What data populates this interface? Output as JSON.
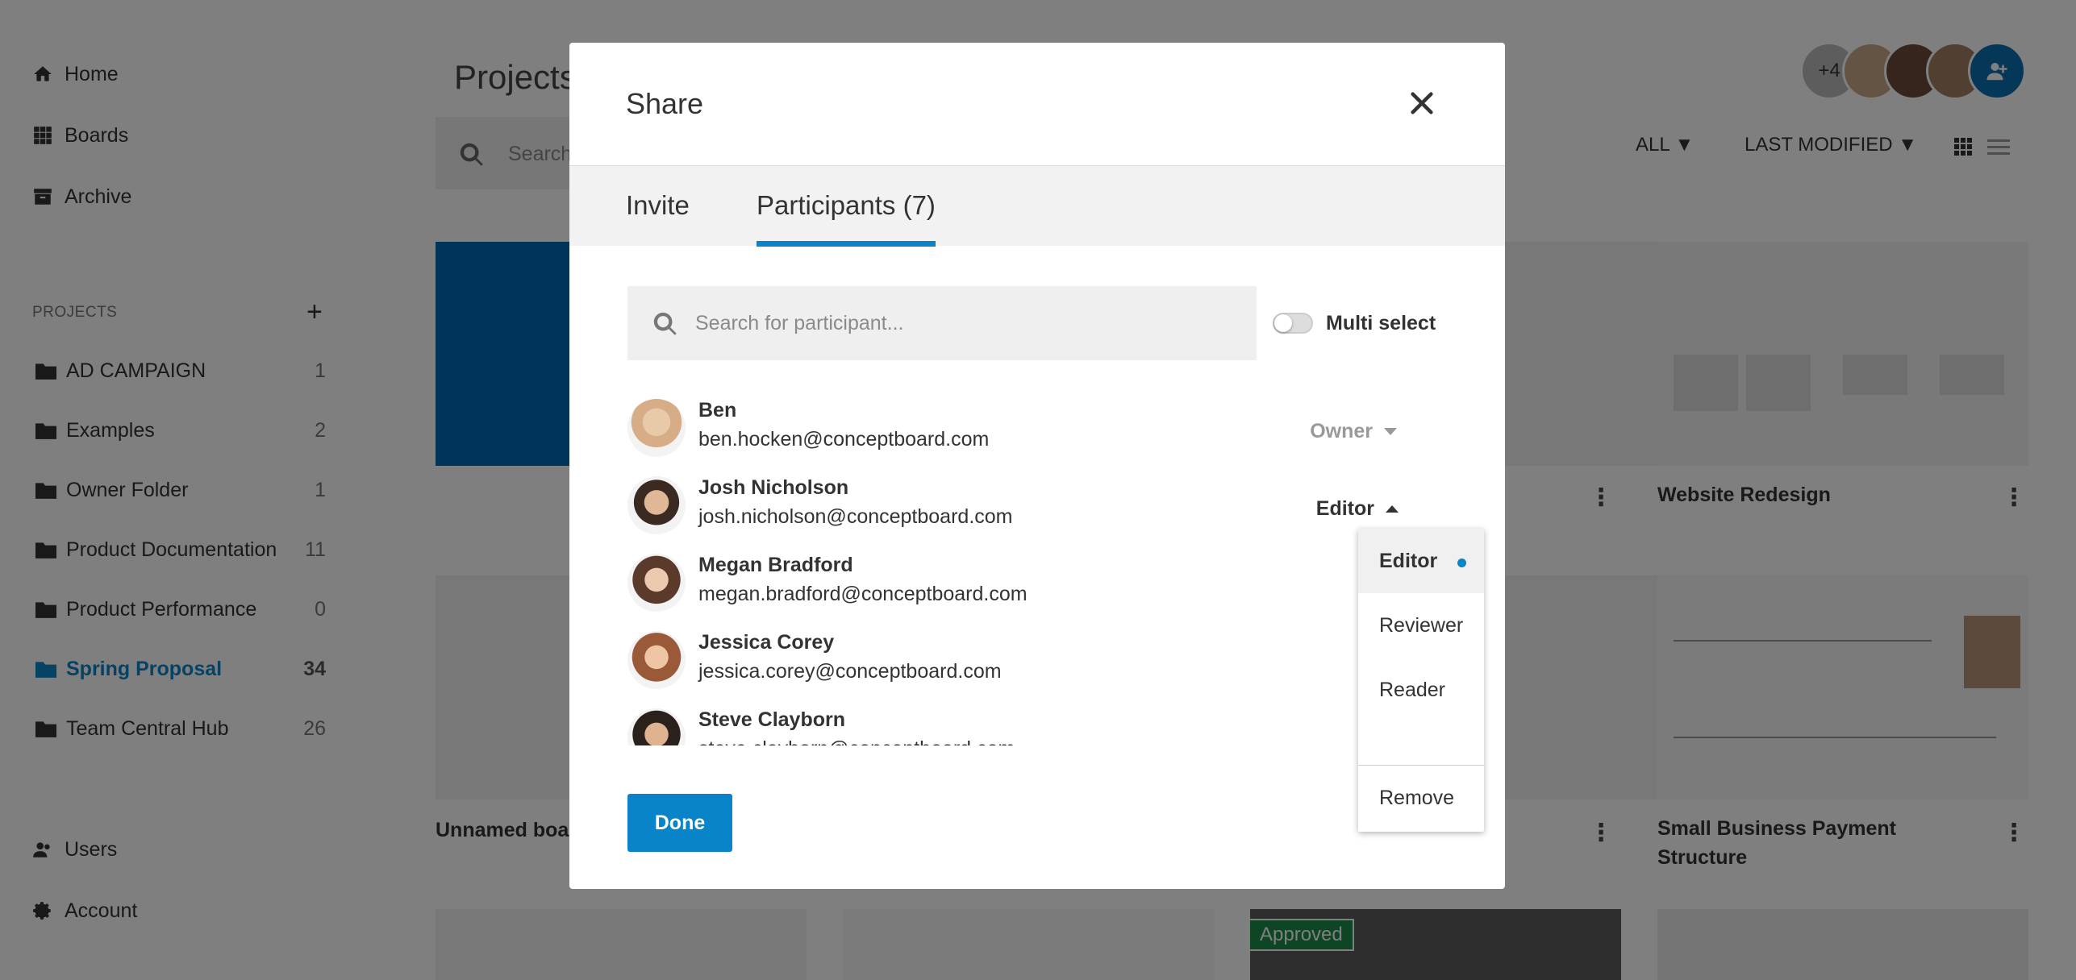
{
  "sidebar": {
    "nav": [
      {
        "label": "Home",
        "icon": "home-icon"
      },
      {
        "label": "Boards",
        "icon": "grid-icon"
      },
      {
        "label": "Archive",
        "icon": "archive-icon"
      }
    ],
    "projects_heading": "PROJECTS",
    "add_symbol": "+",
    "projects": [
      {
        "label": "AD CAMPAIGN",
        "count": "1"
      },
      {
        "label": "Examples",
        "count": "2"
      },
      {
        "label": "Owner Folder",
        "count": "1"
      },
      {
        "label": "Product Documentation",
        "count": "11"
      },
      {
        "label": "Product Performance",
        "count": "0"
      },
      {
        "label": "Spring Proposal",
        "count": "34"
      },
      {
        "label": "Team Central Hub",
        "count": "26"
      }
    ],
    "bottom": [
      {
        "label": "Users",
        "icon": "users-icon"
      },
      {
        "label": "Account",
        "icon": "gear-icon"
      }
    ]
  },
  "header": {
    "title": "Projects",
    "search_placeholder": "Search",
    "filter_all": "ALL ▼",
    "filter_sort": "LAST MODIFIED ▼",
    "avatar_more": "+4"
  },
  "cards": {
    "website_redesign": "Website Redesign",
    "unnamed": "Unnamed boa",
    "small_business": "Small Business Payment",
    "small_business_2": "Structure",
    "approved": "Approved",
    "dots": "⋮"
  },
  "modal": {
    "title": "Share",
    "tabs": {
      "invite": "Invite",
      "participants": "Participants (7)"
    },
    "search_placeholder": "Search for participant...",
    "multi_select": "Multi select",
    "participants": [
      {
        "name": "Ben",
        "email": "ben.hocken@conceptboard.com",
        "role": "Owner"
      },
      {
        "name": "Josh Nicholson",
        "email": "josh.nicholson@conceptboard.com",
        "role": "Editor"
      },
      {
        "name": "Megan Bradford",
        "email": "megan.bradford@conceptboard.com",
        "role": ""
      },
      {
        "name": "Jessica Corey",
        "email": "jessica.corey@conceptboard.com",
        "role": ""
      },
      {
        "name": "Steve Clayborn",
        "email": "steve.clayborn@conceptboard.com",
        "role": ""
      }
    ],
    "role_menu": [
      "Editor",
      "Reviewer",
      "Reader",
      "Remove"
    ],
    "done": "Done"
  },
  "colors": {
    "accent": "#0a84c9",
    "overlay": "rgba(0,0,0,0.5)"
  }
}
